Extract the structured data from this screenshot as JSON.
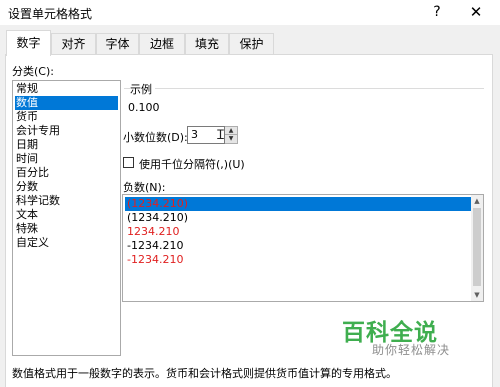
{
  "window": {
    "title": "设置单元格格式",
    "help": "?",
    "close": "✕"
  },
  "tabs": [
    "数字",
    "对齐",
    "字体",
    "边框",
    "填充",
    "保护"
  ],
  "category": {
    "label": "分类(C):",
    "items": [
      "常规",
      "数值",
      "货币",
      "会计专用",
      "日期",
      "时间",
      "百分比",
      "分数",
      "科学记数",
      "文本",
      "特殊",
      "自定义"
    ],
    "selected": "数值"
  },
  "sample": {
    "legend": "示例",
    "value": "0.100"
  },
  "decimal_places": {
    "label": "小数位数(D):",
    "value": "3"
  },
  "thousands_separator": {
    "label": "使用千位分隔符(,)(U)",
    "checked": false
  },
  "negative_numbers": {
    "label": "负数(N):",
    "items": [
      {
        "text": "(1234.210)",
        "red": true,
        "selected": true
      },
      {
        "text": "(1234.210)",
        "red": false,
        "selected": false
      },
      {
        "text": "1234.210",
        "red": true,
        "selected": false
      },
      {
        "text": "-1234.210",
        "red": false,
        "selected": false
      },
      {
        "text": "-1234.210",
        "red": true,
        "selected": false
      }
    ]
  },
  "description": "数值格式用于一般数字的表示。货币和会计格式则提供货币值计算的专用格式。",
  "watermark": {
    "title": "百科全说",
    "subtitle": "助你轻松解决"
  },
  "colors": {
    "selection": "#0078d7",
    "negative_red": "#e02020",
    "watermark_green": "#3fae4f"
  }
}
